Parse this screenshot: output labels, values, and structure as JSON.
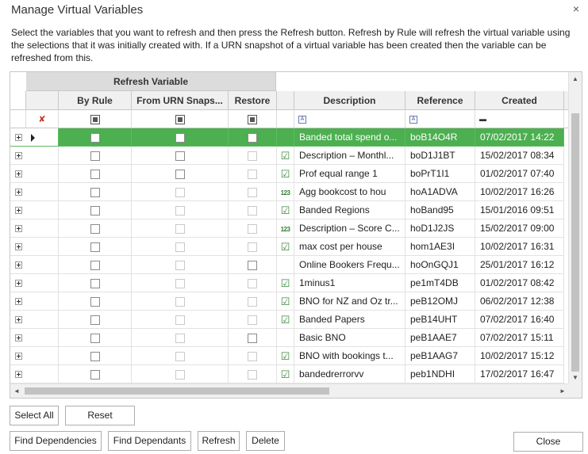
{
  "window": {
    "title": "Manage Virtual Variables",
    "close_icon": "×",
    "description": "Select the variables that you want to refresh and then press the Refresh button.  Refresh by Rule will refresh the virtual variable using the selections that it was initially created with.  If a URN snapshot of a virtual variable has been created then the variable can be refreshed from this."
  },
  "grid": {
    "band_label": "Refresh Variable",
    "columns": {
      "by_rule": "By Rule",
      "from_urn": "From URN Snaps...",
      "restore": "Restore",
      "description": "Description",
      "reference": "Reference",
      "created": "Created"
    },
    "filter": {
      "text_icon": "A",
      "date_icon": "▬"
    },
    "rows": [
      {
        "desc": "Banded total spend o...",
        "ref": "boB14O4R",
        "created": "07/02/2017 14:22",
        "icon": "",
        "selected": true,
        "urn_enabled": true,
        "restore_enabled": true
      },
      {
        "desc": "Description – Monthl...",
        "ref": "boD1J1BT",
        "created": "15/02/2017 08:34",
        "icon": "check",
        "selected": false,
        "urn_enabled": true,
        "restore_enabled": false
      },
      {
        "desc": "Prof equal range 1",
        "ref": "boPrT1I1",
        "created": "01/02/2017 07:40",
        "icon": "check",
        "selected": false,
        "urn_enabled": true,
        "restore_enabled": false
      },
      {
        "desc": "Agg bookcost to hou",
        "ref": "hoA1ADVA",
        "created": "10/02/2017 16:26",
        "icon": "123",
        "selected": false,
        "urn_enabled": false,
        "restore_enabled": false
      },
      {
        "desc": "Banded Regions",
        "ref": "hoBand95",
        "created": "15/01/2016 09:51",
        "icon": "check",
        "selected": false,
        "urn_enabled": false,
        "restore_enabled": false
      },
      {
        "desc": "Description – Score C...",
        "ref": "hoD1J2JS",
        "created": "15/02/2017 09:00",
        "icon": "123",
        "selected": false,
        "urn_enabled": false,
        "restore_enabled": false
      },
      {
        "desc": "max cost per house",
        "ref": "hom1AE3I",
        "created": "10/02/2017 16:31",
        "icon": "check",
        "selected": false,
        "urn_enabled": false,
        "restore_enabled": false
      },
      {
        "desc": "Online Bookers Frequ...",
        "ref": "hoOnGQJ1",
        "created": "25/01/2017 16:12",
        "icon": "",
        "selected": false,
        "urn_enabled": false,
        "restore_enabled": true
      },
      {
        "desc": "1minus1",
        "ref": "pe1mT4DB",
        "created": "01/02/2017 08:42",
        "icon": "check",
        "selected": false,
        "urn_enabled": false,
        "restore_enabled": false
      },
      {
        "desc": "BNO for NZ and Oz tr...",
        "ref": "peB12OMJ",
        "created": "06/02/2017 12:38",
        "icon": "check",
        "selected": false,
        "urn_enabled": false,
        "restore_enabled": false
      },
      {
        "desc": "Banded Papers",
        "ref": "peB14UHT",
        "created": "07/02/2017 16:40",
        "icon": "check2",
        "selected": false,
        "urn_enabled": false,
        "restore_enabled": false
      },
      {
        "desc": "Basic BNO",
        "ref": "peB1AAE7",
        "created": "07/02/2017 15:11",
        "icon": "",
        "selected": false,
        "urn_enabled": false,
        "restore_enabled": true
      },
      {
        "desc": "BNO with bookings t...",
        "ref": "peB1AAG7",
        "created": "10/02/2017 15:12",
        "icon": "check",
        "selected": false,
        "urn_enabled": false,
        "restore_enabled": false
      },
      {
        "desc": "bandedrerrorvv",
        "ref": "peb1NDHI",
        "created": "17/02/2017 16:47",
        "icon": "check",
        "selected": false,
        "urn_enabled": false,
        "restore_enabled": false
      }
    ]
  },
  "buttons": {
    "select_all": "Select All",
    "reset": "Reset",
    "find_dependencies": "Find Dependencies",
    "find_dependants": "Find Dependants",
    "refresh": "Refresh",
    "delete": "Delete",
    "close": "Close"
  },
  "colors": {
    "selected_row": "#4caf50",
    "header_bg": "#f0f0f0",
    "band_bg": "#dcdcdc"
  }
}
